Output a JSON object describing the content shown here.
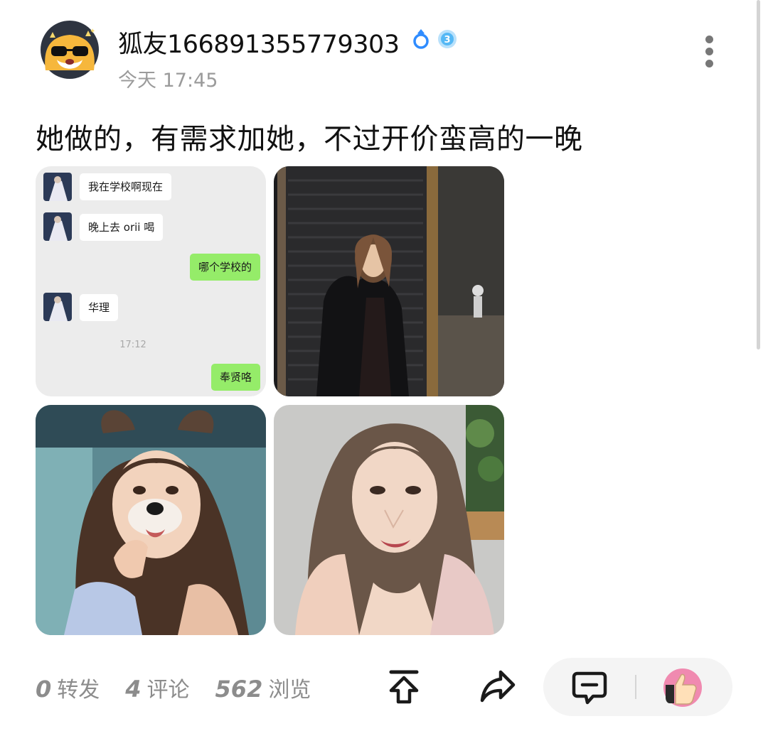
{
  "post": {
    "username": "狐友166891355779303",
    "timestamp": "今天 17:45",
    "text": "她做的，有需求加她，不过开价蛮高的一晚"
  },
  "badges": [
    {
      "icon": "ring-icon",
      "color": "#2f8cff"
    },
    {
      "icon": "level-3-badge-icon",
      "color": "#55b8f5"
    }
  ],
  "images": [
    {
      "kind": "chat-screenshot",
      "messages": [
        {
          "side": "left",
          "text": "我在学校啊现在"
        },
        {
          "side": "left",
          "text": "晚上去 orii 喝"
        },
        {
          "side": "right",
          "text": "哪个学校的"
        },
        {
          "side": "left",
          "text": "华理"
        },
        {
          "side": "time",
          "text": "17:12"
        },
        {
          "side": "right",
          "text": "奉贤咯"
        }
      ]
    },
    {
      "kind": "photo",
      "icon": "photo-street-night"
    },
    {
      "kind": "photo",
      "icon": "photo-selfie-dog-filter"
    },
    {
      "kind": "photo",
      "icon": "photo-selfie-portrait"
    }
  ],
  "stats": {
    "reposts": {
      "count": "0",
      "label": "转发"
    },
    "comments": {
      "count": "4",
      "label": "评论"
    },
    "views": {
      "count": "562",
      "label": "浏览"
    }
  },
  "actions": [
    "pin-top-icon",
    "share-icon",
    "comment-icon",
    "like-avatar-icon"
  ],
  "colors": {
    "chat_bubble_me": "#95ec69",
    "stat_text": "#8c8c8c",
    "timestamp_text": "#9b9b9b"
  }
}
